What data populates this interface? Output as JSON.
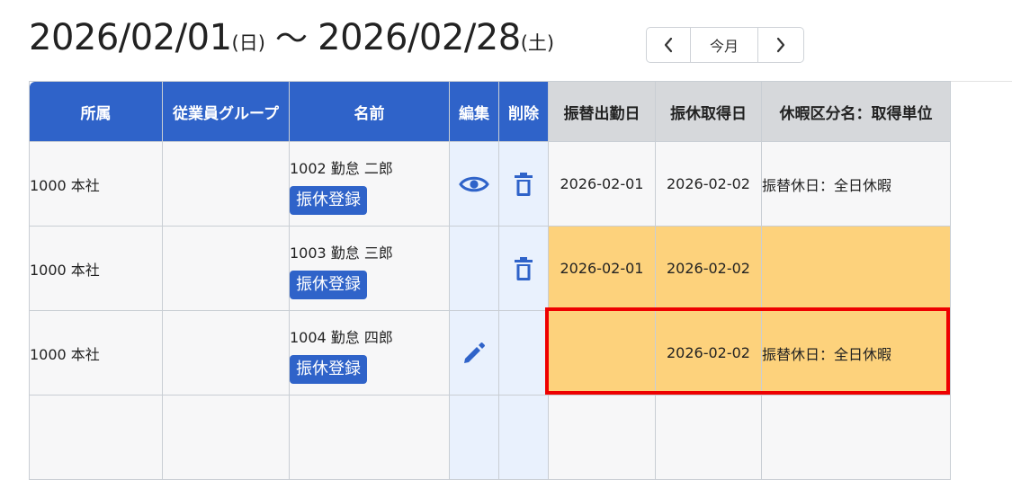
{
  "period": {
    "start": "2026/02/01",
    "start_dow": "(日)",
    "separator": "〜",
    "end": "2026/02/28",
    "end_dow": "(土)"
  },
  "nav": {
    "prev_icon": "chevron-left-icon",
    "today_label": "今月",
    "next_icon": "chevron-right-icon"
  },
  "table": {
    "headers": {
      "affiliation": "所属",
      "employee_group": "従業員グループ",
      "name": "名前",
      "edit": "編集",
      "delete": "削除",
      "substitute_work_date": "振替出勤日",
      "substitute_holiday_date": "振休取得日",
      "leave_type_unit": "休暇区分名：取得単位"
    },
    "rows": [
      {
        "affiliation": "1000 本社",
        "employee_group": "",
        "name": "1002 勤怠 二郎",
        "register_label": "振休登録",
        "edit_icon": "eye-icon",
        "delete_icon": "trash-icon",
        "substitute_work_date": "2026-02-01",
        "substitute_holiday_date": "2026-02-02",
        "leave_type_unit": "振替休日：全日休暇"
      },
      {
        "affiliation": "1000 本社",
        "employee_group": "",
        "name": "1003 勤怠 三郎",
        "register_label": "振休登録",
        "edit_icon": "",
        "delete_icon": "trash-icon",
        "substitute_work_date": "2026-02-01",
        "substitute_holiday_date": "2026-02-02",
        "leave_type_unit": ""
      },
      {
        "affiliation": "1000 本社",
        "employee_group": "",
        "name": "1004 勤怠 四郎",
        "register_label": "振休登録",
        "edit_icon": "pencil-icon",
        "delete_icon": "",
        "substitute_work_date": "",
        "substitute_holiday_date": "2026-02-02",
        "leave_type_unit": "振替休日：全日休暇"
      }
    ]
  },
  "colors": {
    "header_blue": "#2f63c9",
    "header_gray": "#d6d8db",
    "highlight_orange": "#fdd27c",
    "action_column_bg": "#e9f1fd",
    "annotation_red": "#ee0000"
  }
}
